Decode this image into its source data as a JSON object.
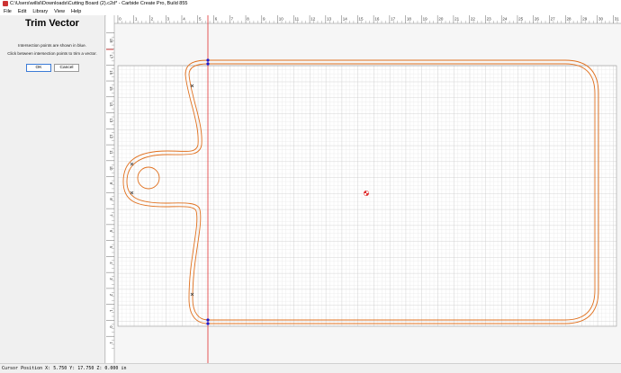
{
  "window": {
    "title": "C:\\Users\\willsl\\Downloads\\Cutting Board (2).c2d* - Carbide Create Pro, Build 855"
  },
  "menu": [
    "File",
    "Edit",
    "Library",
    "View",
    "Help"
  ],
  "panel": {
    "title": "Trim Vector",
    "hint_line1": "Intersection points are shown in blue.",
    "hint_line2": "Click between intersection points to trim a vector.",
    "ok_label": "OK",
    "cancel_label": "Cancel"
  },
  "ruler": {
    "top_ticks": [
      "1",
      "0",
      "1",
      "2",
      "3",
      "4",
      "5",
      "6",
      "7",
      "8",
      "9",
      "10",
      "11",
      "12",
      "13",
      "14",
      "15",
      "16",
      "17",
      "18",
      "19",
      "20",
      "21",
      "22",
      "23",
      "24",
      "25",
      "26",
      "27",
      "28",
      "29",
      "30",
      "31",
      "32"
    ],
    "left_ticks": [
      "19",
      "18",
      "17",
      "16",
      "15",
      "14",
      "13",
      "12",
      "11",
      "10",
      "9",
      "8",
      "7",
      "6",
      "5",
      "4",
      "3",
      "2",
      "1",
      "0",
      "1"
    ]
  },
  "colors": {
    "vector": "#e0701e",
    "guide": "#e03030",
    "grid_minor": "#dcdcdc",
    "grid_major": "#bdbdbd",
    "intersection": "#1a1ad0"
  },
  "status": {
    "cursor_text": "Cursor Position X: 5.750 Y: 17.750 Z: 0.000 in"
  }
}
